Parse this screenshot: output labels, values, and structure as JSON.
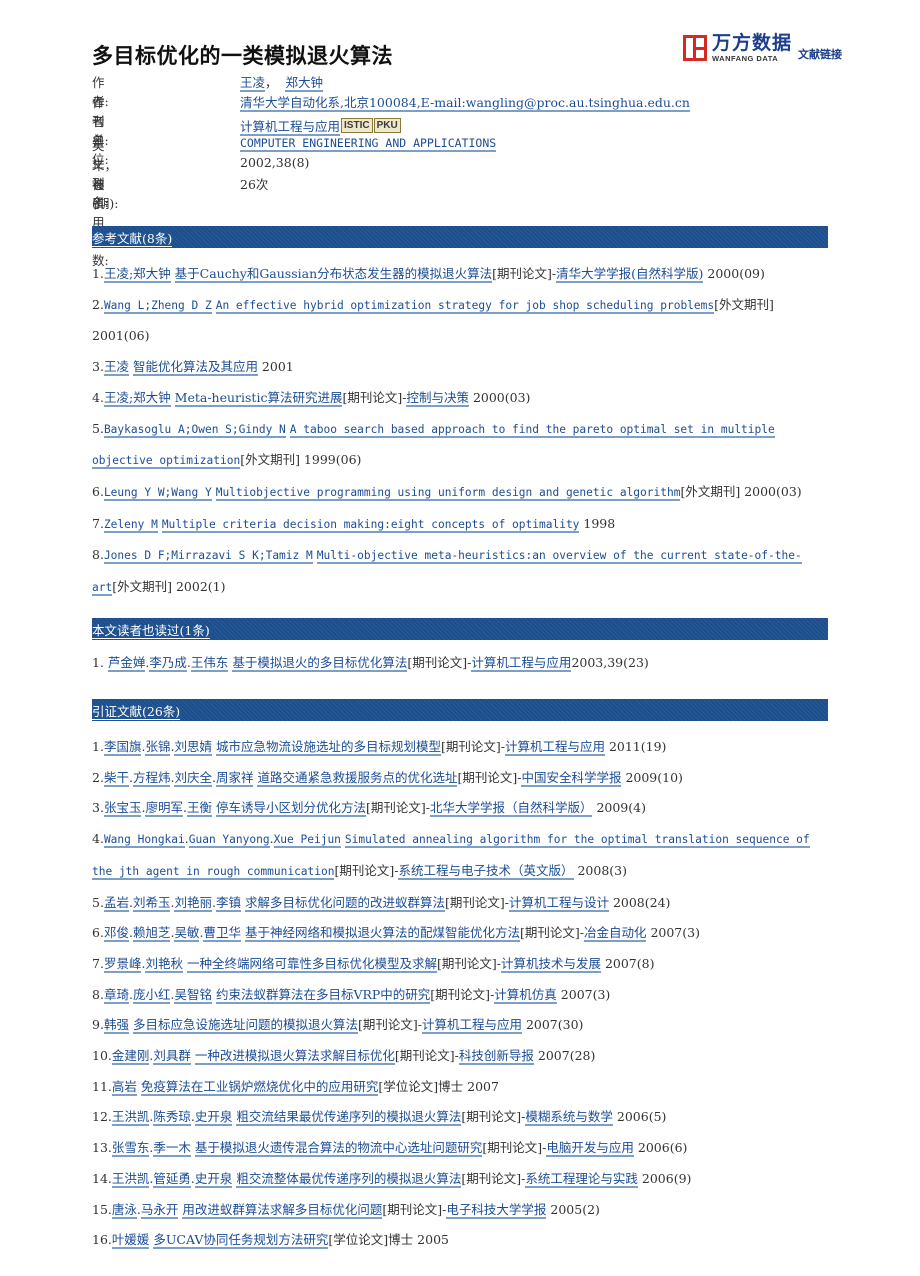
{
  "title": "多目标优化的一类模拟退火算法",
  "logo": {
    "name_cn": "万方数据",
    "name_en": "WANFANG DATA",
    "link_text": "文献链接"
  },
  "meta": {
    "authors_label": "作者:",
    "authors": [
      "王凌",
      "郑大钟"
    ],
    "authors_sep": "，",
    "affiliation_label": "作者单位:",
    "affiliation": "清华大学自动化系,北京100084,E-mail:wangling@proc.au.tsinghua.edu.cn",
    "journal_label": "刊名:",
    "journal": "计算机工程与应用",
    "badges": [
      "ISTIC",
      "PKU"
    ],
    "journal_en_label": "英文刊名:",
    "journal_en": "COMPUTER ENGINEERING AND APPLICATIONS",
    "year_label": "年，卷(期):",
    "year": "2002,38(8)",
    "cited_label": "被引用次数:",
    "cited": "26次"
  },
  "references": {
    "header": "参考文献(8条)",
    "items": [
      {
        "num": "1.",
        "authors": "王凌;郑大钟",
        "title": "基于Cauchy和Gaussian分布状态发生器的模拟退火算法",
        "type": "[期刊论文]",
        "sep": "-",
        "journal": "清华大学学报(自然科学版)",
        "date": " 2000(09)"
      },
      {
        "num": "2.",
        "authors": "Wang L;Zheng D Z",
        "title": "An effective hybrid optimization strategy for job shop scheduling problems",
        "type": "[外文期刊]",
        "sep": "",
        "journal": "",
        "date": " 2001(06)"
      },
      {
        "num": "3.",
        "authors": "王凌",
        "title": "智能优化算法及其应用",
        "type": "",
        "sep": "",
        "journal": "",
        "date": " 2001"
      },
      {
        "num": "4.",
        "authors": "王凌;郑大钟",
        "title": "Meta-heuristic算法研究进展",
        "type": "[期刊论文]",
        "sep": "-",
        "journal": "控制与决策",
        "date": " 2000(03)"
      },
      {
        "num": "5.",
        "authors": "Baykasoglu A;Owen S;Gindy N",
        "title": "A taboo search based approach to find the pareto optimal set in multiple objective optimization",
        "type": "[外文期刊]",
        "sep": "",
        "journal": "",
        "date": " 1999(06)"
      },
      {
        "num": "6.",
        "authors": "Leung Y W;Wang Y",
        "title": "Multiobjective programming using uniform design and genetic algorithm",
        "type": "[外文期刊]",
        "sep": "",
        "journal": "",
        "date": " 2000(03)"
      },
      {
        "num": "7.",
        "authors": "Zeleny M",
        "title": "Multiple criteria decision making:eight concepts of optimality",
        "type": "",
        "sep": "",
        "journal": "",
        "date": " 1998"
      },
      {
        "num": "8.",
        "authors": "Jones D F;Mirrazavi S K;Tamiz M",
        "title": "Multi-objective meta-heuristics:an overview of the current state-of-the-art",
        "type": "[外文期刊]",
        "sep": "",
        "journal": "",
        "date": " 2002(1)"
      }
    ]
  },
  "also_read": {
    "header": "本文读者也读过(1条)",
    "items": [
      {
        "num": "1. ",
        "authors": [
          "芦金婵",
          "李乃成",
          "王伟东"
        ],
        "title": "基于模拟退火的多目标优化算法",
        "type": "[期刊论文]",
        "sep": "-",
        "journal": "计算机工程与应用",
        "date": "2003,39(23)"
      }
    ]
  },
  "citations": {
    "header": "引证文献(26条)",
    "items": [
      {
        "num": "1.",
        "authors": [
          "李国旗",
          "张锦",
          "刘思婧"
        ],
        "title": "城市应急物流设施选址的多目标规划模型",
        "type": "[期刊论文]",
        "sep": "-",
        "journal": "计算机工程与应用",
        "date": " 2011(19)"
      },
      {
        "num": "2.",
        "authors": [
          "柴干",
          "方程炜",
          "刘庆全",
          "周家祥"
        ],
        "title": "道路交通紧急救援服务点的优化选址",
        "type": "[期刊论文]",
        "sep": "-",
        "journal": "中国安全科学学报",
        "date": " 2009(10)"
      },
      {
        "num": "3.",
        "authors": [
          "张宝玉",
          "廖明军",
          "王衡"
        ],
        "title": "停车诱导小区划分优化方法",
        "type": "[期刊论文]",
        "sep": "-",
        "journal": "北华大学学报（自然科学版）",
        "date": " 2009(4)"
      },
      {
        "num": "4.",
        "authors": [
          "Wang Hongkai",
          "Guan Yanyong",
          "Xue Peijun"
        ],
        "title": "Simulated annealing algorithm for the optimal translation sequence of the jth agent in rough communication",
        "type": "[期刊论文]",
        "sep": "-",
        "journal": "系统工程与电子技术（英文版）",
        "date": " 2008(3)"
      },
      {
        "num": "5.",
        "authors": [
          "孟岩",
          "刘希玉",
          "刘艳丽",
          "李镇"
        ],
        "title": "求解多目标优化问题的改进蚁群算法",
        "type": "[期刊论文]",
        "sep": "-",
        "journal": "计算机工程与设计",
        "date": " 2008(24)"
      },
      {
        "num": "6.",
        "authors": [
          "邓俊",
          "赖旭芝",
          "吴敏",
          "曹卫华"
        ],
        "title": "基于神经网络和模拟退火算法的配煤智能优化方法",
        "type": "[期刊论文]",
        "sep": "-",
        "journal": "冶金自动化",
        "date": " 2007(3)"
      },
      {
        "num": "7.",
        "authors": [
          "罗景峰",
          "刘艳秋"
        ],
        "title": "一种全终端网络可靠性多目标优化模型及求解",
        "type": "[期刊论文]",
        "sep": "-",
        "journal": "计算机技术与发展",
        "date": " 2007(8)"
      },
      {
        "num": "8.",
        "authors": [
          "章琦",
          "庞小红",
          "吴智铭"
        ],
        "title": "约束法蚁群算法在多目标VRP中的研究",
        "type": "[期刊论文]",
        "sep": "-",
        "journal": "计算机仿真",
        "date": " 2007(3)"
      },
      {
        "num": "9.",
        "authors": [
          "韩强"
        ],
        "title": "多目标应急设施选址问题的模拟退火算法",
        "type": "[期刊论文]",
        "sep": "-",
        "journal": "计算机工程与应用",
        "date": " 2007(30)"
      },
      {
        "num": "10.",
        "authors": [
          "金建刚",
          "刘具群"
        ],
        "title": "一种改进模拟退火算法求解目标优化",
        "type": "[期刊论文]",
        "sep": "-",
        "journal": "科技创新导报",
        "date": " 2007(28)"
      },
      {
        "num": "11.",
        "authors": [
          "高岩"
        ],
        "title": "免疫算法在工业锅炉燃烧优化中的应用研究",
        "type": "[学位论文]博士",
        "sep": "",
        "journal": "",
        "date": " 2007"
      },
      {
        "num": "12.",
        "authors": [
          "王洪凯",
          "陈秀琼",
          "史开泉"
        ],
        "title": "粗交流结果最优传递序列的模拟退火算法",
        "type": "[期刊论文]",
        "sep": "-",
        "journal": "模糊系统与数学",
        "date": " 2006(5)"
      },
      {
        "num": "13.",
        "authors": [
          "张雪东",
          "季一木"
        ],
        "title": "基于模拟退火遗传混合算法的物流中心选址问题研究",
        "type": "[期刊论文]",
        "sep": "-",
        "journal": "电脑开发与应用",
        "date": " 2006(6)"
      },
      {
        "num": "14.",
        "authors": [
          "王洪凯",
          "管延勇",
          "史开泉"
        ],
        "title": "粗交流整体最优传递序列的模拟退火算法",
        "type": "[期刊论文]",
        "sep": "-",
        "journal": "系统工程理论与实践",
        "date": " 2006(9)"
      },
      {
        "num": "15.",
        "authors": [
          "唐泳",
          "马永开"
        ],
        "title": "用改进蚁群算法求解多目标优化问题",
        "type": "[期刊论文]",
        "sep": "-",
        "journal": "电子科技大学学报",
        "date": " 2005(2)"
      },
      {
        "num": "16.",
        "authors": [
          "叶媛媛"
        ],
        "title": "多UCAV协同任务规划方法研究",
        "type": "[学位论文]博士",
        "sep": "",
        "journal": "",
        "date": " 2005"
      }
    ]
  }
}
